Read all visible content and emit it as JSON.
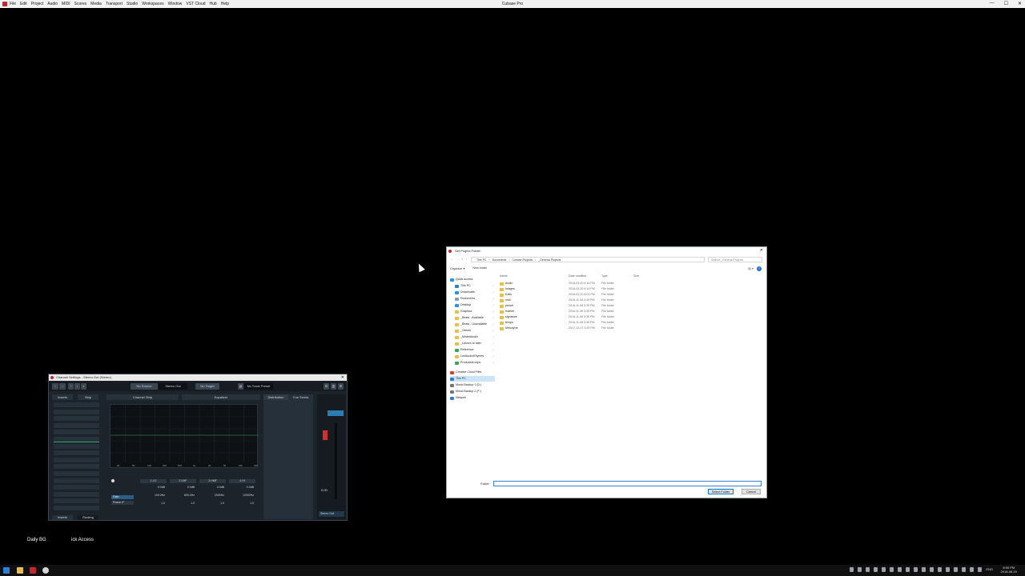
{
  "app": {
    "title": "Cubase Pro",
    "menus": [
      "File",
      "Edit",
      "Project",
      "Audio",
      "MIDI",
      "Scores",
      "Media",
      "Transport",
      "Studio",
      "Workspaces",
      "Window",
      "VST Cloud",
      "Hub",
      "Help"
    ]
  },
  "channel_window": {
    "title": "Channel Settings - Stereo Out (Stereo)",
    "toolbar": {
      "no_source": "No Source",
      "output": "Stereo Out",
      "no_target": "No Target",
      "no_track_preset": "No Track Preset"
    },
    "tabs": {
      "inserts": "Inserts",
      "strip": "Strip",
      "channel_strip": "Channel Strip",
      "equalizer": "Equalizer",
      "distribution": "Distribution",
      "cue_sends": "Cue Sends"
    },
    "eq_freq_labels": [
      "20",
      "50",
      "100",
      "200",
      "500",
      "1k",
      "2k",
      "5k",
      "10k",
      "20k"
    ],
    "bands": [
      {
        "name": "1 LO",
        "gain": "0.0dB",
        "freq": "100.0Hz",
        "q": "1.0"
      },
      {
        "name": "2 LMF",
        "gain": "0.0dB",
        "freq": "600.0Hz",
        "q": "1.0"
      },
      {
        "name": "3 HMF",
        "gain": "0.0dB",
        "freq": "2000Hz",
        "q": "1.0"
      },
      {
        "name": "4 HI",
        "gain": "0.0dB",
        "freq": "12000Hz",
        "q": "1.0"
      }
    ],
    "pre": {
      "gain": "Gain",
      "phase": "Phase 0°"
    },
    "fader_value": "0.00",
    "fader_output": "Stereo Out",
    "bottom_tabs": {
      "inserts": "Inserts",
      "routing": "Routing"
    }
  },
  "dialog": {
    "title": "Set Project Folder",
    "path": [
      "This PC",
      "Documents",
      "Cubase Projects",
      "_General Projects"
    ],
    "search_placeholder": "Search _General Projects",
    "organize": "Organize ▾",
    "new_folder": "New folder",
    "help": "?",
    "columns": {
      "name": "Name",
      "date": "Date modified",
      "type": "Type",
      "size": "Size"
    },
    "nav": [
      {
        "label": "Quick access",
        "color": "#2f8fe0",
        "pinned": false,
        "indent": 0
      },
      {
        "label": "This PC",
        "color": "#3a7bc8",
        "pinned": true,
        "indent": 1
      },
      {
        "label": "Downloads",
        "color": "#2f8fe0",
        "pinned": true,
        "indent": 1
      },
      {
        "label": "Documents",
        "color": "#8a9bb0",
        "pinned": true,
        "indent": 1
      },
      {
        "label": "Desktop",
        "color": "#2f8fe0",
        "pinned": true,
        "indent": 1
      },
      {
        "label": "Graphics",
        "color": "#e8bd4f",
        "pinned": true,
        "indent": 1
      },
      {
        "label": "_Beats - Available",
        "color": "#e8bd4f",
        "pinned": true,
        "indent": 1
      },
      {
        "label": "_Beats - Unavailable",
        "color": "#e8bd4f",
        "pinned": true,
        "indent": 1
      },
      {
        "label": "_Clients",
        "color": "#e8bd4f",
        "pinned": true,
        "indent": 1
      },
      {
        "label": "_MintedAudio",
        "color": "#e8bd4f",
        "pinned": true,
        "indent": 1
      },
      {
        "label": "_Launch to later",
        "color": "#e8bd4f",
        "pinned": true,
        "indent": 1
      },
      {
        "label": "Reference",
        "color": "#3aa757",
        "pinned": true,
        "indent": 1
      },
      {
        "label": "LostAudioRhymes",
        "color": "#e8bd4f",
        "pinned": true,
        "indent": 1
      },
      {
        "label": "ProducedLoops",
        "color": "#3aa757",
        "pinned": true,
        "indent": 1
      },
      {
        "label": "Creative Cloud Files",
        "color": "#d93a3a",
        "pinned": false,
        "indent": 0
      },
      {
        "label": "This PC",
        "color": "#3a7bc8",
        "pinned": false,
        "indent": 0,
        "selected": true
      },
      {
        "label": "Music Backup 1 (D:)",
        "color": "#777777",
        "pinned": false,
        "indent": 0
      },
      {
        "label": "Music Backup 2 (F:)",
        "color": "#777777",
        "pinned": false,
        "indent": 0
      },
      {
        "label": "Network",
        "color": "#3a7bc8",
        "pinned": false,
        "indent": 0
      }
    ],
    "files": [
      {
        "name": "Audio",
        "date": "2018-03-20 6:18 PM",
        "type": "File folder"
      },
      {
        "name": "Images",
        "date": "2018-03-20 6:14 PM",
        "type": "File folder"
      },
      {
        "name": "Edits",
        "date": "2018-03-20 6:03 PM",
        "type": "File folder"
      },
      {
        "name": "midi",
        "date": "2018-11-08 3:39 PM",
        "type": "File folder"
      },
      {
        "name": "preset",
        "date": "2018-11-08 3:39 PM",
        "type": "File folder"
      },
      {
        "name": "marker",
        "date": "2018-11-08 3:39 PM",
        "type": "File folder"
      },
      {
        "name": "signature",
        "date": "2018-11-08 3:39 PM",
        "type": "File folder"
      },
      {
        "name": "tempo",
        "date": "2018-11-08 3:39 PM",
        "type": "File folder"
      },
      {
        "name": "Melodyne",
        "date": "2017-12-27 3:39 PM",
        "type": "File folder"
      }
    ],
    "folder_label": "Folder:",
    "folder_value": "",
    "select_button": "Select Folder",
    "cancel_button": "Cancel"
  },
  "desktop": {
    "icons": [
      "Daily BG",
      "ick Access"
    ]
  },
  "taskbar": {
    "time": "8:55 PM",
    "date": "2018-08-20",
    "lang": "ENG"
  }
}
